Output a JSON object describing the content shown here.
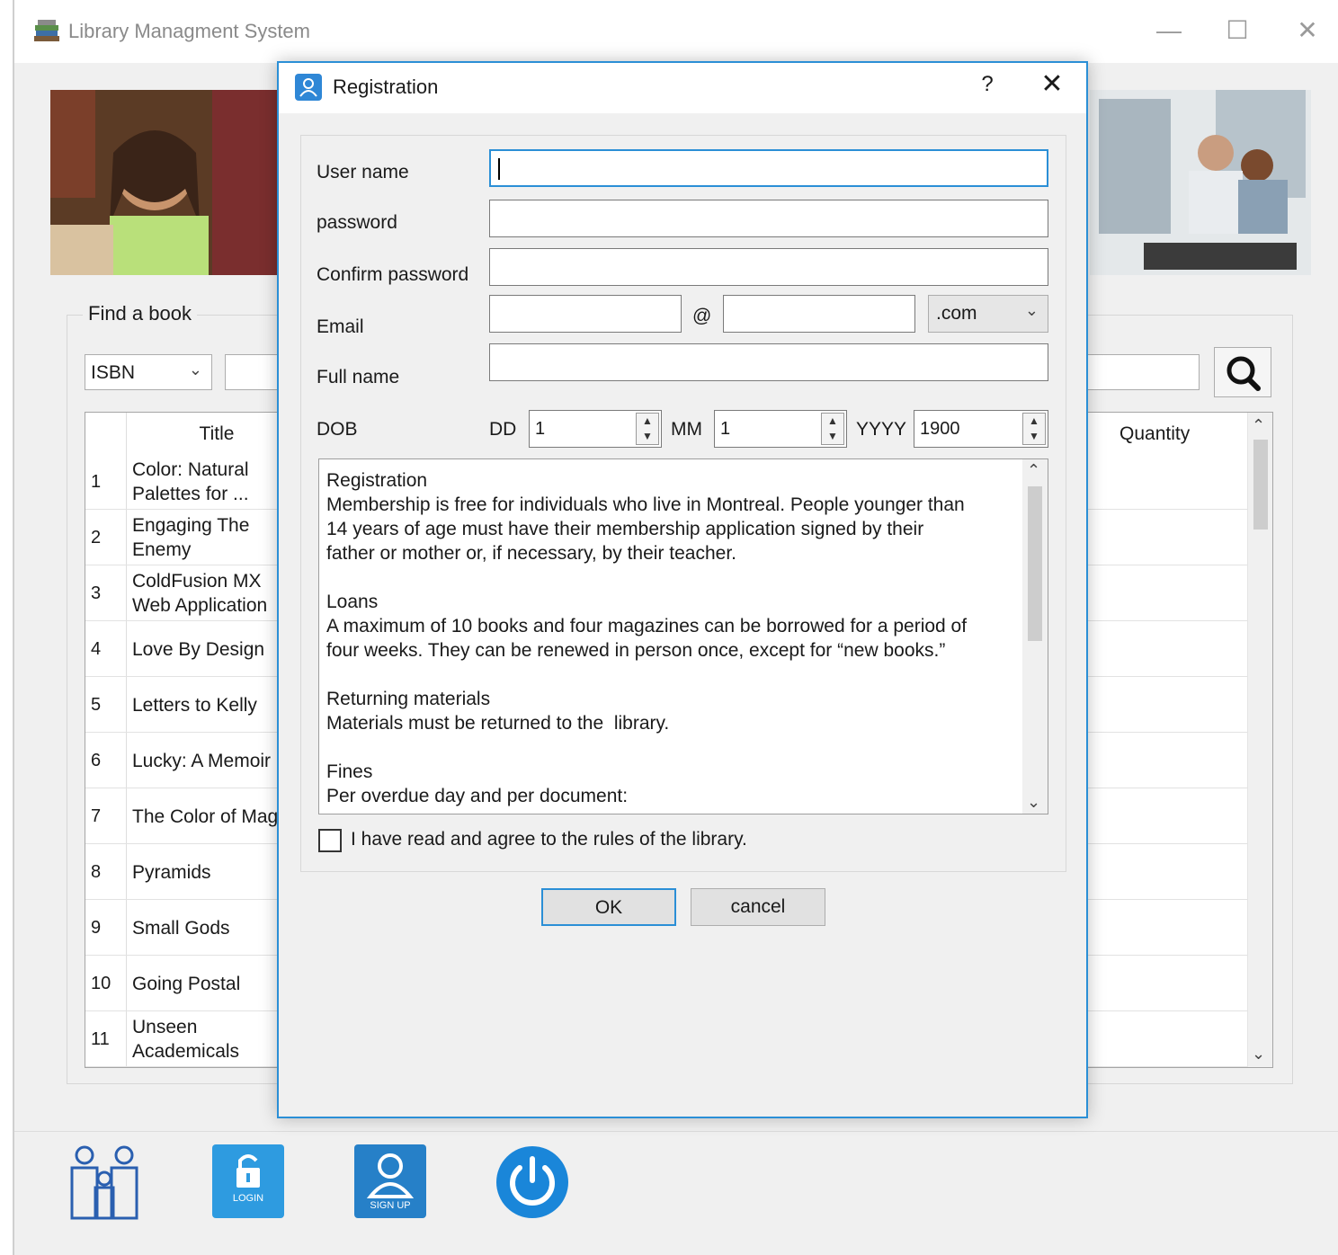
{
  "window": {
    "title": "Library Managment System",
    "minimize": "—",
    "maximize": "☐",
    "close": "✕"
  },
  "find": {
    "legend": "Find a book",
    "search_type": "ISBN"
  },
  "table": {
    "headers": {
      "title": "Title",
      "quantity": "Quantity"
    },
    "rows": [
      {
        "num": "1",
        "title": "Color: Natural Palettes for ..."
      },
      {
        "num": "2",
        "title": "Engaging The Enemy"
      },
      {
        "num": "3",
        "title": "ColdFusion MX Web Application"
      },
      {
        "num": "4",
        "title": "Love By Design"
      },
      {
        "num": "5",
        "title": "Letters to Kelly"
      },
      {
        "num": "6",
        "title": "Lucky: A Memoir"
      },
      {
        "num": "7",
        "title": "The Color of Mag"
      },
      {
        "num": "8",
        "title": "Pyramids"
      },
      {
        "num": "9",
        "title": "Small Gods"
      },
      {
        "num": "10",
        "title": "Going Postal"
      },
      {
        "num": "11",
        "title": "Unseen Academicals"
      }
    ]
  },
  "bottom_bar": {
    "login_label": "LOGIN",
    "signup_label": "SIGN UP",
    "icons": [
      "family-icon",
      "login-icon",
      "signup-icon",
      "power-icon"
    ]
  },
  "dialog": {
    "title": "Registration",
    "help": "?",
    "close": "✕",
    "labels": {
      "username": "User name",
      "password": "password",
      "confirm": "Confirm password",
      "email": "Email",
      "fullname": "Full name",
      "dob": "DOB",
      "dd": "DD",
      "mm": "MM",
      "yyyy": "YYYY",
      "at": "@"
    },
    "values": {
      "email_domain": ".com",
      "dd": "1",
      "mm": "1",
      "yyyy": "1900"
    },
    "rules_text": "Registration\nMembership is free for individuals who live in Montreal. People younger than\n14 years of age must have their membership application signed by their\nfather or mother or, if necessary, by their teacher.\n\nLoans\nA maximum of 10 books and four magazines can be borrowed for a period of\nfour weeks. They can be renewed in person once, except for “new books.”\n\nReturning materials\nMaterials must be returned to the  library.\n\nFines\nPer overdue day and per document:",
    "agree_label": "I have read and agree to the rules of the library.",
    "ok": "OK",
    "cancel": "cancel"
  },
  "colors": {
    "accent": "#2b8fd6",
    "login_tile": "#2e9be0",
    "signup_tile": "#2680c8",
    "power": "#1a86d9"
  }
}
